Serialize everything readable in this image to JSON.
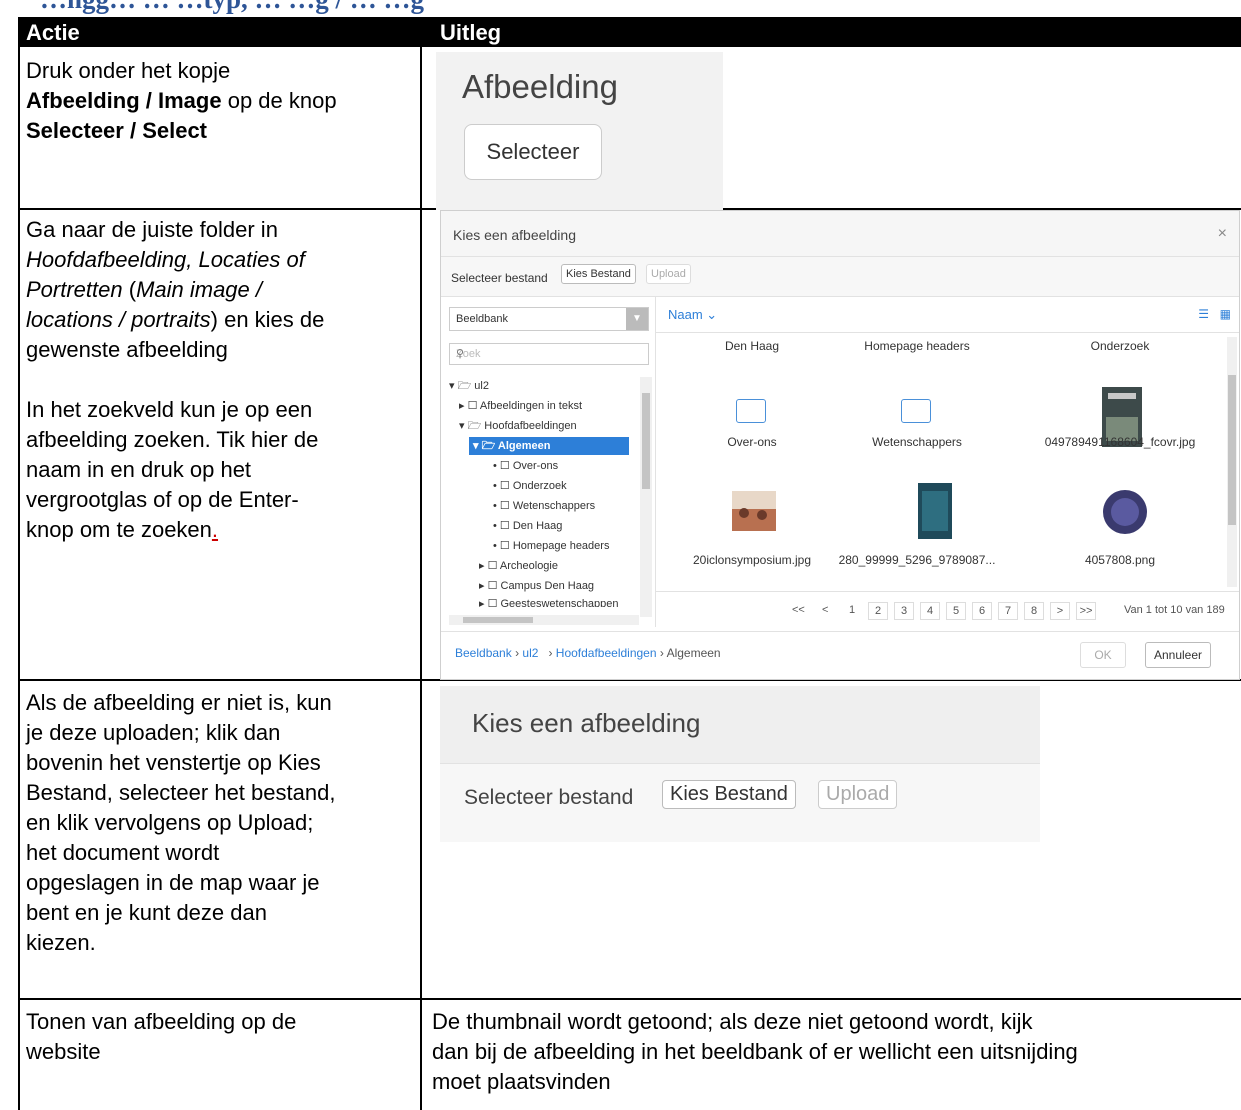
{
  "heading": "…ngg… … …typ, … …g / … …g",
  "table": {
    "header": {
      "col1": "Actie",
      "col2": "Uitleg"
    },
    "row1": {
      "l1": "Druk onder het kopje",
      "l2_bold": "Afbeelding / Image",
      "l2_rest": " op de knop",
      "l3_bold": "Selecteer / Select"
    },
    "row2": {
      "l1": "Ga naar de juiste folder in",
      "l2_it": "Hoofdafbeelding, Locaties of",
      "l3_it": "Portretten",
      "l3_rest": " (",
      "l3_it2": "Main image /",
      "l4_it": "locations / portraits",
      "l4_rest": ") en kies de",
      "l5": "gewenste afbeelding",
      "p2_l1": "In het zoekveld kun je op een",
      "p2_l2": "afbeelding zoeken. Tik hier de",
      "p2_l3": "naam in en druk op het",
      "p2_l4": "vergrootglas of op de Enter-",
      "p2_l5": "knop om te zoeken",
      "p2_dot": "."
    },
    "row3": {
      "lines": [
        "Als de afbeelding er niet is, kun",
        "je deze uploaden; klik dan",
        "bovenin het venstertje op Kies",
        "Bestand, selecteer het bestand,",
        "en klik vervolgens op Upload;",
        "het document wordt",
        "opgeslagen in de map waar je",
        "bent en je kunt deze dan",
        "kiezen."
      ]
    },
    "row4": {
      "left": [
        "Tonen van afbeelding op de",
        "website"
      ],
      "right": [
        "De  thumbnail wordt getoond; als deze niet getoond wordt, kijk",
        "dan bij de afbeelding in het beeldbank of er wellicht een uitsnijding",
        "moet plaatsvinden"
      ]
    }
  },
  "shot1": {
    "title": "Afbeelding",
    "button": "Selecteer"
  },
  "dialog": {
    "title": "Kies een afbeelding",
    "close": "×",
    "upload_label": "Selecteer bestand",
    "choose_file": "Kies Bestand",
    "upload": "Upload",
    "source": "Beeldbank",
    "search_placeholder": "Zoek",
    "tree": [
      "ul2",
      "Afbeeldingen in tekst",
      "Hoofdafbeeldingen",
      "Algemeen",
      "Over-ons",
      "Onderzoek",
      "Wetenschappers",
      "Den Haag",
      "Homepage headers",
      "Archeologie",
      "Campus Den Haag",
      "Geesteswetenschappen"
    ],
    "sort": "Naam ⌄",
    "items": [
      "Den Haag",
      "Homepage headers",
      "Onderzoek",
      "Over-ons",
      "Wetenschappers",
      "049789491168604_fcovr.jpg",
      "20iclonsymposium.jpg",
      "280_99999_5296_9789087...",
      "4057808.png"
    ],
    "pager": {
      "first": "<<",
      "prev": "<",
      "pages": [
        "1",
        "2",
        "3",
        "4",
        "5",
        "6",
        "7",
        "8"
      ],
      "next": ">",
      "last": ">>",
      "summary": "Van 1 tot 10 van 189"
    },
    "crumbs": [
      "Beeldbank",
      "ul2",
      "Hoofdafbeeldingen",
      "Algemeen"
    ],
    "ok": "OK",
    "cancel": "Annuleer"
  },
  "shot3": {
    "title": "Kies een afbeelding",
    "label": "Selecteer bestand",
    "choose_file": "Kies Bestand",
    "upload": "Upload"
  }
}
